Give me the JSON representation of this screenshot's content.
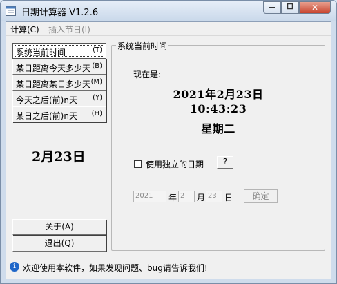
{
  "window": {
    "title": "日期计算器  V1.2.6"
  },
  "menu": {
    "items": [
      "计算(C)",
      "插入节日(I)"
    ]
  },
  "sidebar": {
    "buttons": [
      {
        "label": "系统当前时间",
        "key": "(T)"
      },
      {
        "label": "某日距离今天多少天",
        "key": "(B)"
      },
      {
        "label": "某日距离某日多少天",
        "key": "(M)"
      },
      {
        "label": "今天之后(前)n天",
        "key": "(Y)"
      },
      {
        "label": "某日之后(前)n天",
        "key": "(H)"
      }
    ],
    "today": "2月23日",
    "about_label": "关于(A)",
    "exit_label": "退出(Q)"
  },
  "panel": {
    "legend": "系统当前时间",
    "now_label": "现在是:",
    "date": "2021年2月23日",
    "time": "10:43:23",
    "weekday": "星期二",
    "checkbox_label": "使用独立的日期",
    "help_label": "?",
    "year_value": "2021",
    "year_unit": "年",
    "month_value": "2",
    "month_unit": "月",
    "day_value": "23",
    "day_unit": "日",
    "ok_label": "确定"
  },
  "status": {
    "text": "欢迎使用本软件，如果发现问题、bug请告诉我们!"
  },
  "colors": {
    "accent": "#1f66c8",
    "close": "#c8452f"
  }
}
